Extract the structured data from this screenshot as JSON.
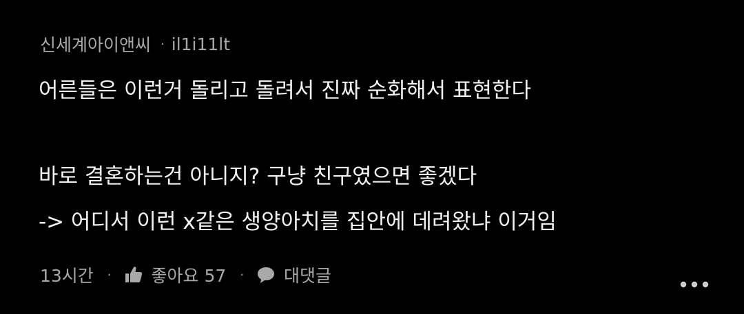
{
  "comment": {
    "author": "신세계아이앤씨",
    "separator": "·",
    "user_id": "il1i11lt",
    "lines": [
      "어른들은 이런거 돌리고 돌려서 진짜 순화해서 표현한다",
      "바로 결혼하는건 아니지? 구냥 친구였으면 좋겠다",
      "-> 어디서 이런 x같은 생양아치를 집안에 데려왔냐  이거임"
    ],
    "time": "13시간",
    "dot": "·",
    "like_label": "좋아요 57",
    "reply_label": "대댓글"
  },
  "icons": {
    "like": "thumbs-up-icon",
    "reply": "speech-bubble-icon",
    "more": "more-dots-icon"
  },
  "colors": {
    "background": "#000000",
    "text": "#f2f2f2",
    "meta": "#a8a8a8"
  }
}
